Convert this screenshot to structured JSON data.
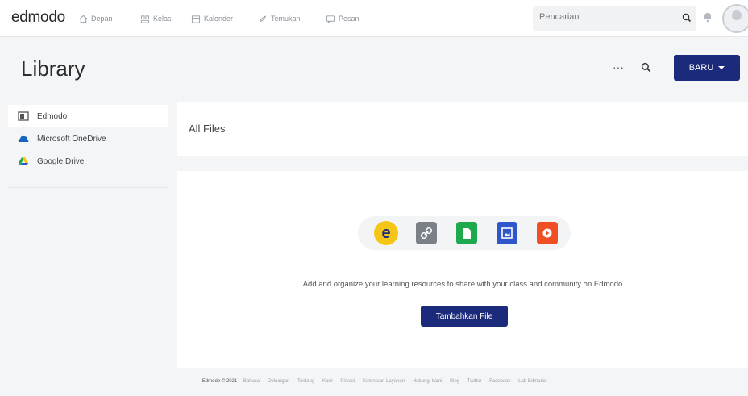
{
  "nav": {
    "logo": "edmodo",
    "items": [
      {
        "label": "Depan",
        "icon": "home-icon"
      },
      {
        "label": "Kelas",
        "icon": "classes-icon"
      },
      {
        "label": "Kalender",
        "icon": "calendar-icon"
      },
      {
        "label": "Temukan",
        "icon": "discover-icon"
      },
      {
        "label": "Pesan",
        "icon": "messages-icon"
      }
    ],
    "search_placeholder": "Pencarian"
  },
  "header": {
    "title": "Library",
    "more_label": "···",
    "new_button": "BARU"
  },
  "sidebar": {
    "items": [
      {
        "label": "Edmodo",
        "icon": "edmodo-library-icon"
      },
      {
        "label": "Microsoft OneDrive",
        "icon": "onedrive-icon"
      },
      {
        "label": "Google Drive",
        "icon": "google-drive-icon"
      }
    ]
  },
  "main": {
    "section_title": "All Files",
    "empty_message": "Add and organize your learning resources to share with your class and community on Edmodo",
    "add_button": "Tambahkan File",
    "resource_icons": [
      "edmodo-e-icon",
      "link-icon",
      "document-icon",
      "image-icon",
      "video-icon"
    ]
  },
  "footer": {
    "copyright": "Edmodo © 2021",
    "links": [
      "Bahasa",
      "Dukungan",
      "Tentang",
      "Karir",
      "Privasi",
      "Ketentuan Layanan",
      "Hubungi kami",
      "Blog",
      "Twitter",
      "Facebook",
      "Lab Edmodo"
    ]
  },
  "colors": {
    "primary": "#1b2a7a",
    "accent_yellow": "#f5c518",
    "doc_green": "#1fa94f",
    "image_blue": "#2f57c9",
    "video_orange": "#f04e23"
  }
}
